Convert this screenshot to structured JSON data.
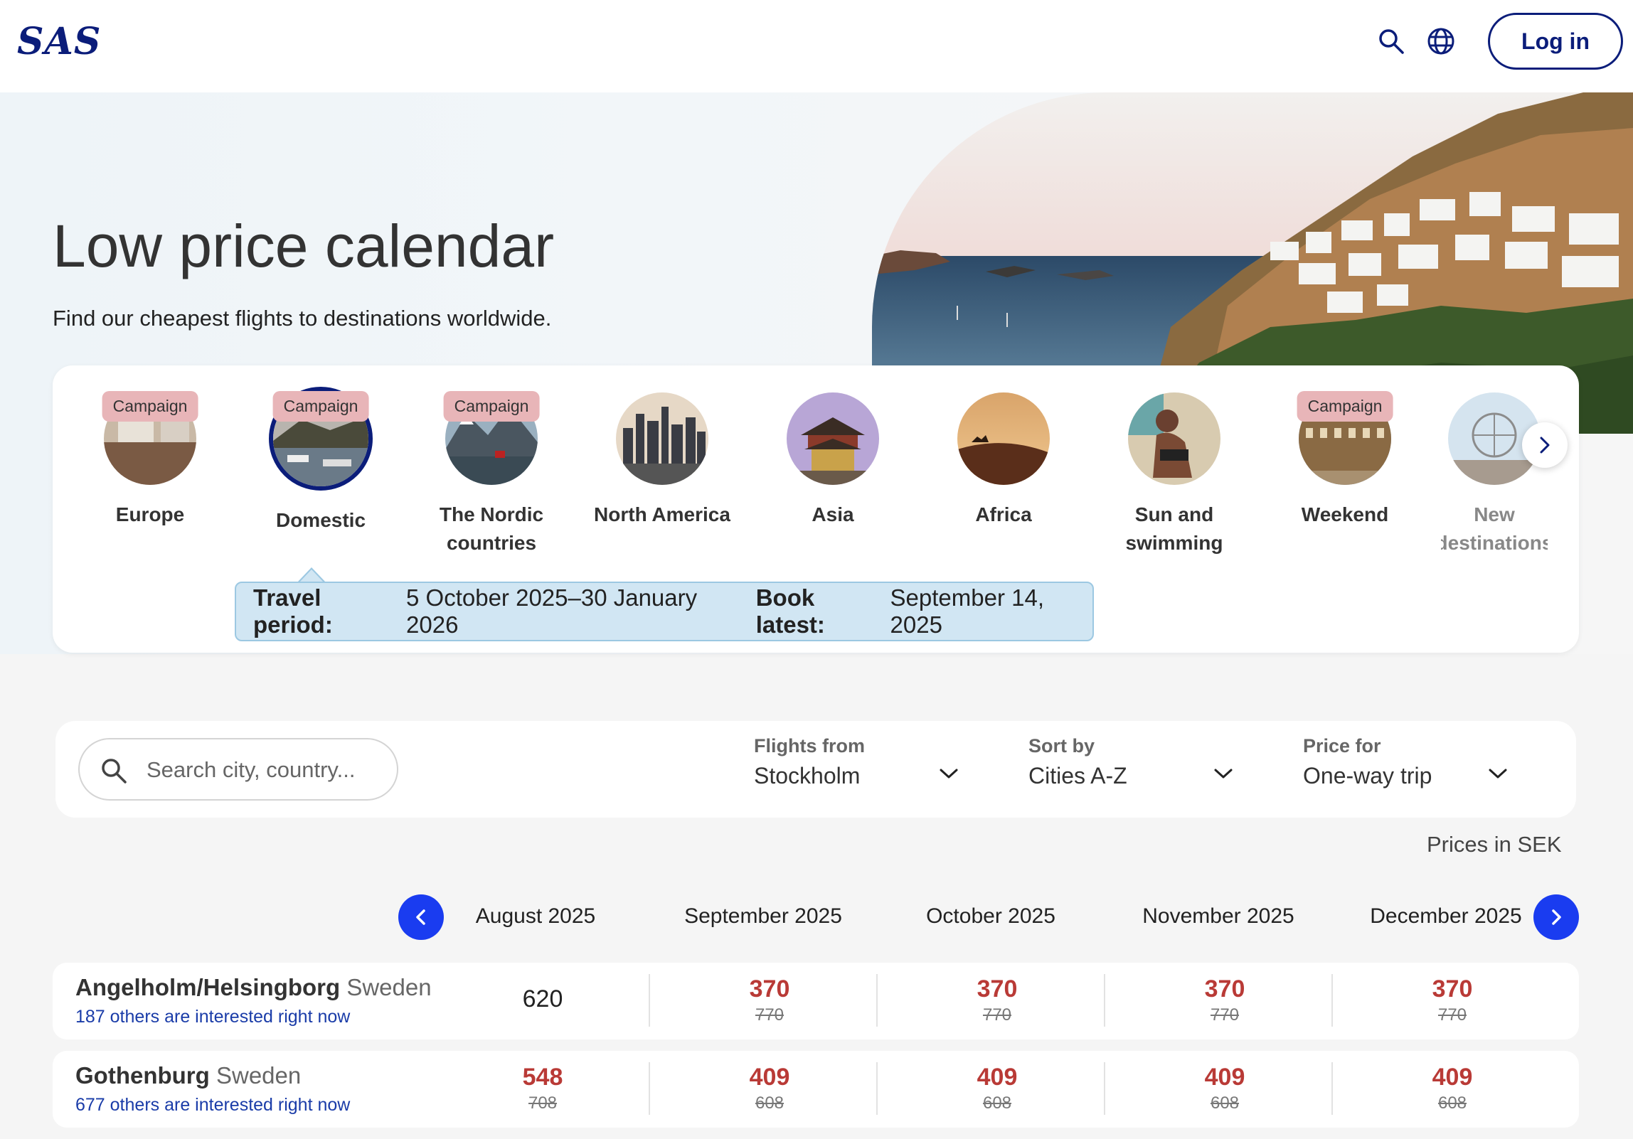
{
  "header": {
    "logo": "SAS",
    "login_label": "Log in"
  },
  "hero": {
    "title": "Low price calendar",
    "subtitle": "Find our cheapest flights to destinations worldwide."
  },
  "categories": [
    {
      "label": "Europe",
      "badge": "Campaign"
    },
    {
      "label": "Domestic",
      "badge": "Campaign",
      "active": true
    },
    {
      "label": "The Nordic countries",
      "badge": "Campaign"
    },
    {
      "label": "North America",
      "badge": ""
    },
    {
      "label": "Asia",
      "badge": ""
    },
    {
      "label": "Africa",
      "badge": ""
    },
    {
      "label": "Sun and swimming",
      "badge": ""
    },
    {
      "label": "Weekend",
      "badge": "Campaign"
    },
    {
      "label": "New destinations",
      "badge": ""
    }
  ],
  "info": {
    "period_label": "Travel period:",
    "period_value": "5 October 2025–30 January 2026",
    "book_label": "Book latest:",
    "book_value": "September 14, 2025"
  },
  "filters": {
    "search_placeholder": "Search city, country...",
    "from_label": "Flights from",
    "from_value": "Stockholm",
    "sort_label": "Sort by",
    "sort_value": "Cities A-Z",
    "price_label": "Price for",
    "price_value": "One-way trip"
  },
  "prices_note": "Prices in SEK",
  "months": [
    "August 2025",
    "September 2025",
    "October 2025",
    "November 2025",
    "December 2025"
  ],
  "rows": [
    {
      "city": "Angelholm/Helsingborg",
      "country": "Sweden",
      "interest": "187 others are interested right now",
      "prices": [
        {
          "price": "620",
          "old": ""
        },
        {
          "price": "370",
          "old": "770"
        },
        {
          "price": "370",
          "old": "770"
        },
        {
          "price": "370",
          "old": "770"
        },
        {
          "price": "370",
          "old": "770"
        }
      ]
    },
    {
      "city": "Gothenburg",
      "country": "Sweden",
      "interest": "677 others are interested right now",
      "prices": [
        {
          "price": "548",
          "old": "708"
        },
        {
          "price": "409",
          "old": "608"
        },
        {
          "price": "409",
          "old": "608"
        },
        {
          "price": "409",
          "old": "608"
        },
        {
          "price": "409",
          "old": "608"
        }
      ]
    }
  ],
  "colors": {
    "brand": "#0b1d7a",
    "accent_blue": "#1a3cf0",
    "campaign_price": "#b93a36",
    "badge_bg": "#e8b5b8",
    "info_bg": "#d1e6f3"
  }
}
